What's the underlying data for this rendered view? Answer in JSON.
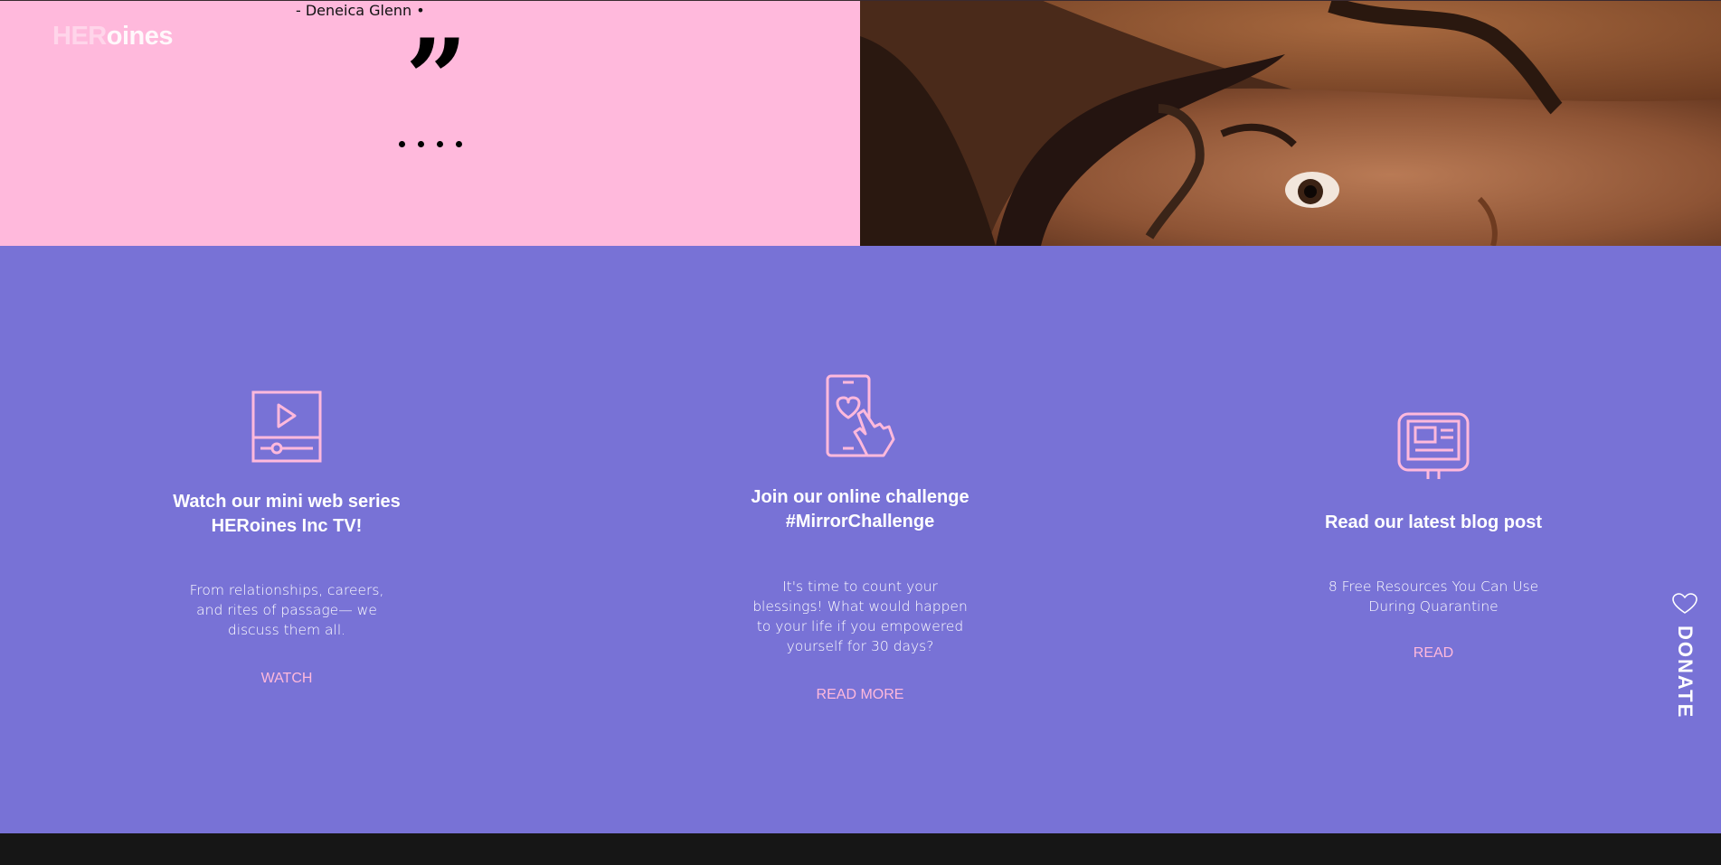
{
  "brand": {
    "logo_part_a": "HER",
    "logo_part_b": "oines"
  },
  "testimonial": {
    "attribution": "- Deneica Glenn •",
    "quote_glyph": "”",
    "dots": [
      "slide-1",
      "slide-2",
      "slide-3",
      "slide-4"
    ]
  },
  "features": [
    {
      "icon": "video-player-icon",
      "title_line1": "Watch our mini web series",
      "title_line2": "HERoines Inc TV!",
      "description": "From relationships, careers, and rites of passage— we discuss them all.",
      "link": "WATCH"
    },
    {
      "icon": "phone-heart-tap-icon",
      "title_line1": "Join our online challenge",
      "title_line2": "#MirrorChallenge",
      "description": "It's time to count your blessings! What would happen to your life if you empowered yourself for 30 days?",
      "link": "READ MORE"
    },
    {
      "icon": "computer-monitor-icon",
      "title_line1": "Read our latest blog post",
      "title_line2": "",
      "description": "8 Free Resources You Can Use During Quarantine",
      "link": "READ"
    }
  ],
  "donate": {
    "label": "DONATE",
    "icon": "heart-outline-icon"
  },
  "colors": {
    "quote_bg": "#ffb9dc",
    "features_bg": "#7872d6",
    "accent_pink": "#ffb9dc",
    "footer_bg": "#161616"
  }
}
